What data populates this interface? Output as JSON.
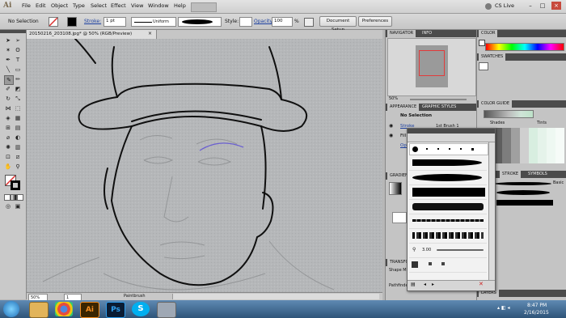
{
  "menubar": {
    "items": [
      "File",
      "Edit",
      "Object",
      "Type",
      "Select",
      "Effect",
      "View",
      "Window",
      "Help"
    ],
    "cs_live": "CS Live"
  },
  "controlbar": {
    "selection": "No Selection",
    "stroke_label": "Stroke:",
    "stroke_value": "1 pt",
    "uniform": "Uniform",
    "style_label": "Style:",
    "opacity_label": "Opacity:",
    "opacity_value": "100",
    "percent": "%",
    "document_setup": "Document Setup",
    "preferences": "Preferences"
  },
  "document": {
    "tab_title": "20150216_203108.jpg* @ 50% (RGB/Preview)",
    "zoom": "50%",
    "page": "1",
    "status": "Paintbrush"
  },
  "panels": {
    "navigator_tab": "NAVIGATOR",
    "info_tab": "INFO",
    "nav_zoom": "50%",
    "color_tab": "COLOR",
    "swatches_tab": "SWATCHES",
    "appearance_tab": "APPEARANCE",
    "graphic_styles_tab": "GRAPHIC STYLES",
    "appearance_no_selection": "No Selection",
    "appearance_stroke": "Stroke",
    "appearance_fill": "Fill",
    "appearance_opacity": "Opacity",
    "appearance_brush": "1st Brush 1",
    "color_guide_tab": "COLOR GUIDE",
    "shades": "Shades",
    "tints": "Tints",
    "gradient_tab": "GRADIENT",
    "stroke_tab": "STROKE",
    "symbols_tab": "SYMBOLS",
    "basic": "Basic",
    "transform_tab": "TRANSFORM",
    "shape_modes": "Shape M",
    "pathfinder": "Pathfinder",
    "layers_tab": "LAYERS"
  },
  "brushes_panel": {
    "size_value": "3.00"
  },
  "taskbar": {
    "time": "8:47 PM",
    "date": "2/16/2015"
  },
  "colors": {
    "accent_red": "#d9302f",
    "ai_orange": "#f48c1f",
    "canvas_paper": "#b4b6b8"
  }
}
